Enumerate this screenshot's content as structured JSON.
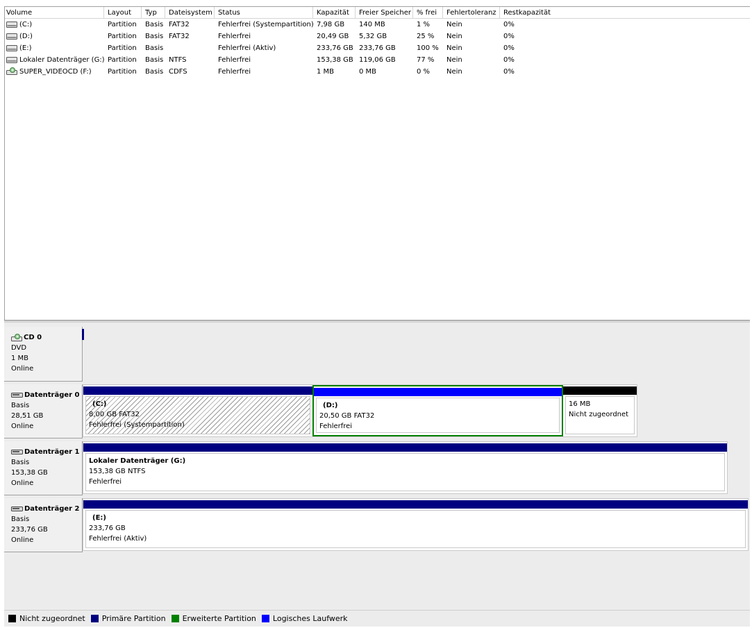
{
  "list": {
    "headers": [
      "Volume",
      "Layout",
      "Typ",
      "Dateisystem",
      "Status",
      "Kapazität",
      "Freier Speicher",
      "% frei",
      "Fehlertoleranz",
      "Restkapazität"
    ],
    "rows": [
      {
        "icon": "drive-icon",
        "volume": "(C:)",
        "layout": "Partition",
        "typ": "Basis",
        "fs": "FAT32",
        "status": "Fehlerfrei (Systempartition)",
        "cap": "7,98 GB",
        "free": "140 MB",
        "pct": "1 %",
        "ft": "Nein",
        "rest": "0%"
      },
      {
        "icon": "drive-icon",
        "volume": "(D:)",
        "layout": "Partition",
        "typ": "Basis",
        "fs": "FAT32",
        "status": "Fehlerfrei",
        "cap": "20,49 GB",
        "free": "5,32 GB",
        "pct": "25 %",
        "ft": "Nein",
        "rest": "0%"
      },
      {
        "icon": "drive-icon",
        "volume": "(E:)",
        "layout": "Partition",
        "typ": "Basis",
        "fs": "",
        "status": "Fehlerfrei (Aktiv)",
        "cap": "233,76 GB",
        "free": "233,76 GB",
        "pct": "100 %",
        "ft": "Nein",
        "rest": "0%"
      },
      {
        "icon": "drive-icon",
        "volume": "Lokaler Datenträger (G:)",
        "layout": "Partition",
        "typ": "Basis",
        "fs": "NTFS",
        "status": "Fehlerfrei",
        "cap": "153,38 GB",
        "free": "119,06 GB",
        "pct": "77 %",
        "ft": "Nein",
        "rest": "0%"
      },
      {
        "icon": "cd-drive-icon",
        "volume": "SUPER_VIDEOCD (F:)",
        "layout": "Partition",
        "typ": "Basis",
        "fs": "CDFS",
        "status": "Fehlerfrei",
        "cap": "1 MB",
        "free": "0 MB",
        "pct": "0 %",
        "ft": "Nein",
        "rest": "0%"
      }
    ]
  },
  "disks": {
    "cd0": {
      "title": "CD 0",
      "type": "DVD",
      "size": "1 MB",
      "state": "Online"
    },
    "d0": {
      "title": "Datenträger 0",
      "type": "Basis",
      "size": "28,51 GB",
      "state": "Online",
      "parts": [
        {
          "name": "(C:)",
          "size": "8,00 GB FAT32",
          "status": "Fehlerfrei (Systempartition)"
        },
        {
          "name": "(D:)",
          "size": "20,50 GB FAT32",
          "status": "Fehlerfrei"
        },
        {
          "name": "",
          "size": "16 MB",
          "status": "Nicht zugeordnet"
        }
      ]
    },
    "d1": {
      "title": "Datenträger 1",
      "type": "Basis",
      "size": "153,38 GB",
      "state": "Online",
      "parts": [
        {
          "name": "Lokaler Datenträger  (G:)",
          "size": "153,38 GB NTFS",
          "status": "Fehlerfrei"
        }
      ]
    },
    "d2": {
      "title": "Datenträger 2",
      "type": "Basis",
      "size": "233,76 GB",
      "state": "Online",
      "parts": [
        {
          "name": "(E:)",
          "size": "233,76 GB",
          "status": "Fehlerfrei (Aktiv)"
        }
      ]
    }
  },
  "legend": [
    {
      "label": "Nicht zugeordnet",
      "color": "#000000"
    },
    {
      "label": "Primäre Partition",
      "color": "#000080"
    },
    {
      "label": "Erweiterte Partition",
      "color": "#008000"
    },
    {
      "label": "Logisches Laufwerk",
      "color": "#0000ff"
    }
  ]
}
